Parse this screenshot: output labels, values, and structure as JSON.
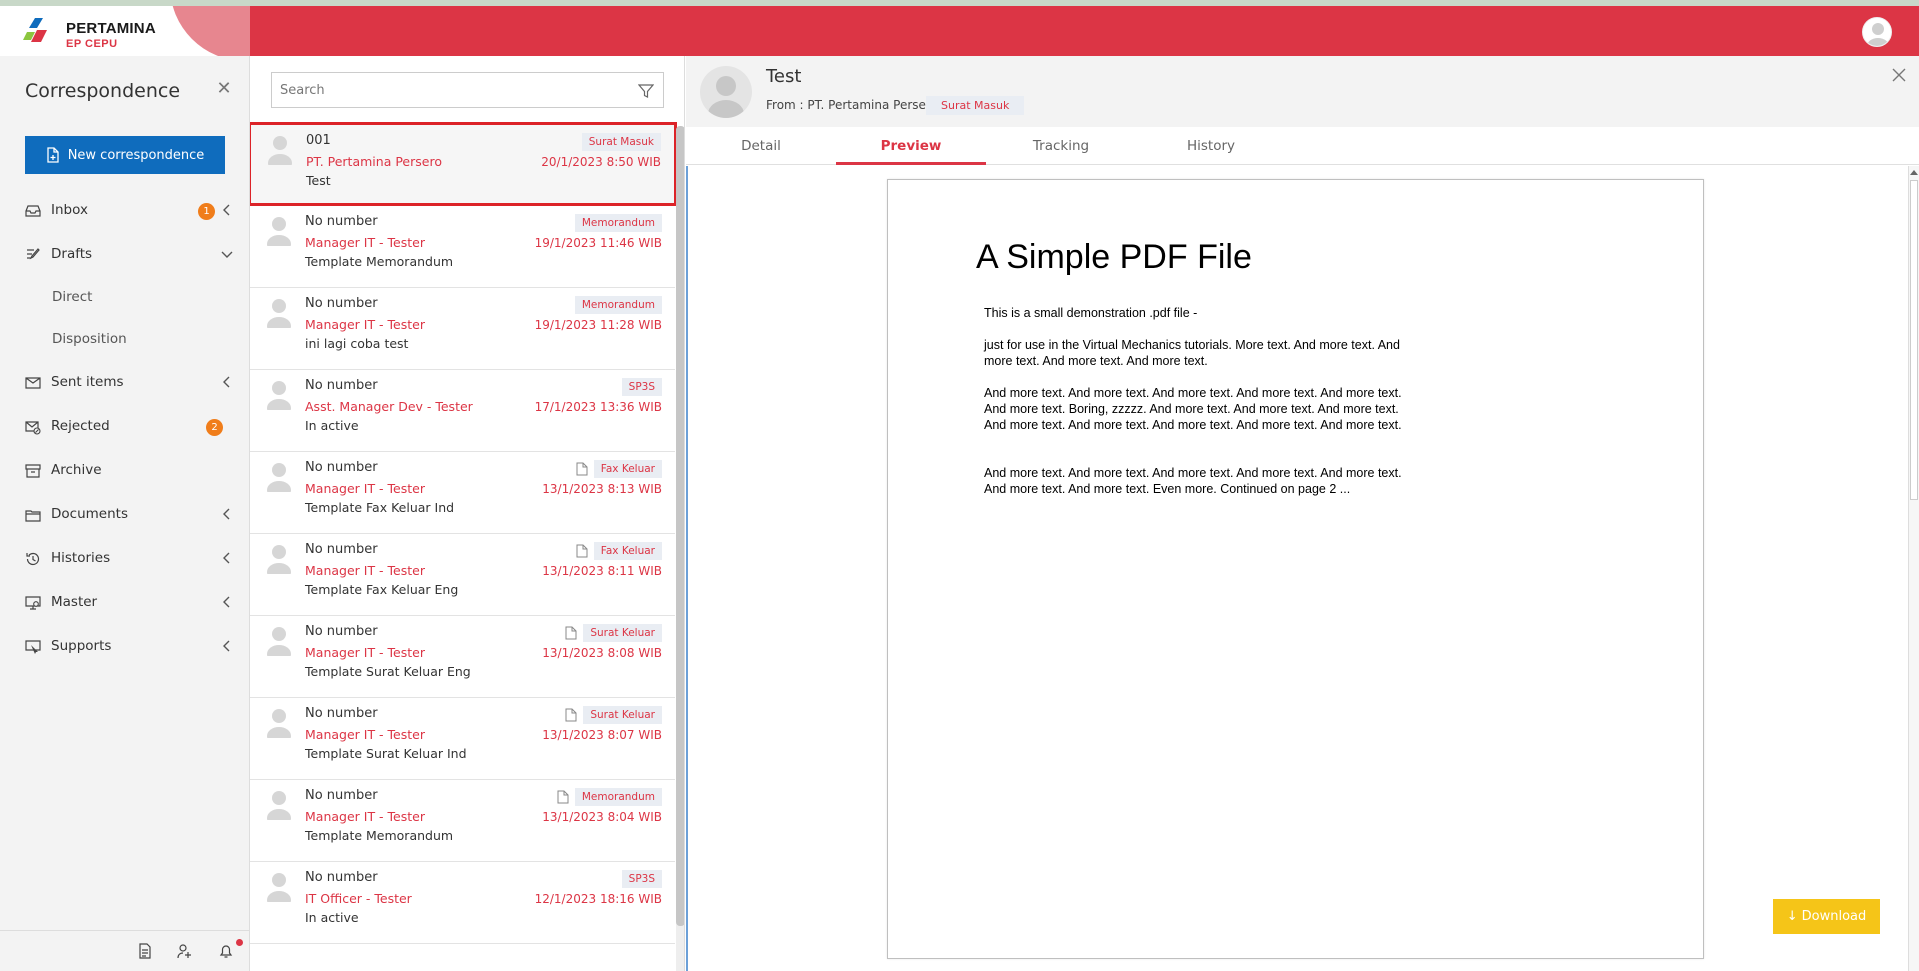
{
  "brand": {
    "name": "PERTAMINA",
    "sub": "EP CEPU"
  },
  "sidebar": {
    "title": "Correspondence",
    "new_button": "New correspondence",
    "items": [
      {
        "label": "Inbox",
        "icon": "inbox-icon",
        "badge": "1",
        "chevron": "left"
      },
      {
        "label": "Drafts",
        "icon": "drafts-icon",
        "chevron": "down"
      },
      {
        "label": "Direct",
        "sub": true
      },
      {
        "label": "Disposition",
        "sub": true
      },
      {
        "label": "Sent items",
        "icon": "sent-icon",
        "chevron": "left"
      },
      {
        "label": "Rejected",
        "icon": "rejected-icon",
        "badge": "2"
      },
      {
        "label": "Archive",
        "icon": "archive-icon"
      },
      {
        "label": "Documents",
        "icon": "documents-icon",
        "chevron": "left"
      },
      {
        "label": "Histories",
        "icon": "history-icon",
        "chevron": "left"
      },
      {
        "label": "Master",
        "icon": "master-icon",
        "chevron": "left"
      },
      {
        "label": "Supports",
        "icon": "supports-icon",
        "chevron": "left"
      }
    ],
    "footer_icons": [
      "document-icon",
      "user-settings-icon",
      "bell-icon"
    ]
  },
  "search": {
    "placeholder": "Search",
    "value": ""
  },
  "list": [
    {
      "number": "001",
      "from": "PT. Pertamina Persero",
      "subject": "Test",
      "tag": "Surat Masuk",
      "date": "20/1/2023 8:50 WIB",
      "attachment": false,
      "selected": true
    },
    {
      "number": "No number",
      "from": "Manager IT - Tester",
      "subject": "Template Memorandum",
      "tag": "Memorandum",
      "date": "19/1/2023 11:46 WIB",
      "attachment": false
    },
    {
      "number": "No number",
      "from": "Manager IT - Tester",
      "subject": "ini lagi coba test",
      "tag": "Memorandum",
      "date": "19/1/2023 11:28 WIB",
      "attachment": false
    },
    {
      "number": "No number",
      "from": "Asst. Manager Dev - Tester",
      "subject": "In active",
      "tag": "SP3S",
      "date": "17/1/2023 13:36 WIB",
      "attachment": false
    },
    {
      "number": "No number",
      "from": "Manager IT - Tester",
      "subject": "Template Fax Keluar Ind",
      "tag": "Fax Keluar",
      "date": "13/1/2023 8:13 WIB",
      "attachment": true
    },
    {
      "number": "No number",
      "from": "Manager IT - Tester",
      "subject": "Template Fax Keluar Eng",
      "tag": "Fax Keluar",
      "date": "13/1/2023 8:11 WIB",
      "attachment": true
    },
    {
      "number": "No number",
      "from": "Manager IT - Tester",
      "subject": "Template Surat Keluar Eng",
      "tag": "Surat Keluar",
      "date": "13/1/2023 8:08 WIB",
      "attachment": true
    },
    {
      "number": "No number",
      "from": "Manager IT - Tester",
      "subject": "Template Surat Keluar Ind",
      "tag": "Surat Keluar",
      "date": "13/1/2023 8:07 WIB",
      "attachment": true
    },
    {
      "number": "No number",
      "from": "Manager IT - Tester",
      "subject": "Template Memorandum",
      "tag": "Memorandum",
      "date": "13/1/2023 8:04 WIB",
      "attachment": true
    },
    {
      "number": "No number",
      "from": "IT Officer - Tester",
      "subject": "In active",
      "tag": "SP3S",
      "date": "12/1/2023 18:16 WIB",
      "attachment": false
    }
  ],
  "detail": {
    "title": "Test",
    "from": "From : PT. Pertamina Persero",
    "tag": "Surat Masuk",
    "tabs": [
      "Detail",
      "Preview",
      "Tracking",
      "History"
    ],
    "active_tab": "Preview",
    "download": "Download"
  },
  "pdf": {
    "title": "A Simple PDF File",
    "paragraphs": [
      "This is a small demonstration .pdf file -",
      "just for use in the Virtual Mechanics tutorials. More text. And more text. And more text. And more text. And more text.",
      "And more text. And more text. And more text. And more text. And more text. And more text. Boring, zzzzz. And more text. And more text. And more text. And more text. And more text. And more text. And more text. And more text.",
      "And more text. And more text. And more text. And more text. And more text. And more text. And more text. Even more. Continued on page 2 ..."
    ]
  },
  "colors": {
    "brand_red": "#dc3545",
    "primary_blue": "#0f6cbd",
    "download_yellow": "#f5c518",
    "badge_orange": "#f07d1a"
  }
}
